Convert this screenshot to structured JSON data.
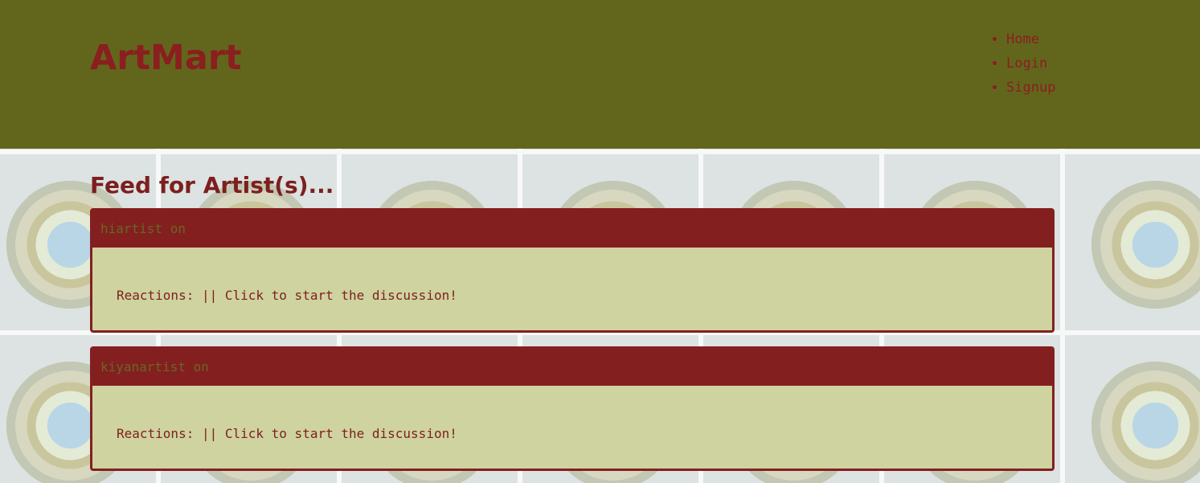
{
  "header": {
    "brand": "ArtMart",
    "nav": [
      {
        "label": "Home"
      },
      {
        "label": "Login"
      },
      {
        "label": "Signup"
      }
    ]
  },
  "main": {
    "title": "Feed for Artist(s)...",
    "posts": [
      {
        "header": "hiartist on",
        "body": "Reactions: || Click to start the discussion!"
      },
      {
        "header": "kiyanartist on",
        "body": "Reactions: || Click to start the discussion!"
      }
    ]
  },
  "colors": {
    "header_bg": "#62661c",
    "accent": "#841f20",
    "card_bg": "#cfd39f"
  }
}
